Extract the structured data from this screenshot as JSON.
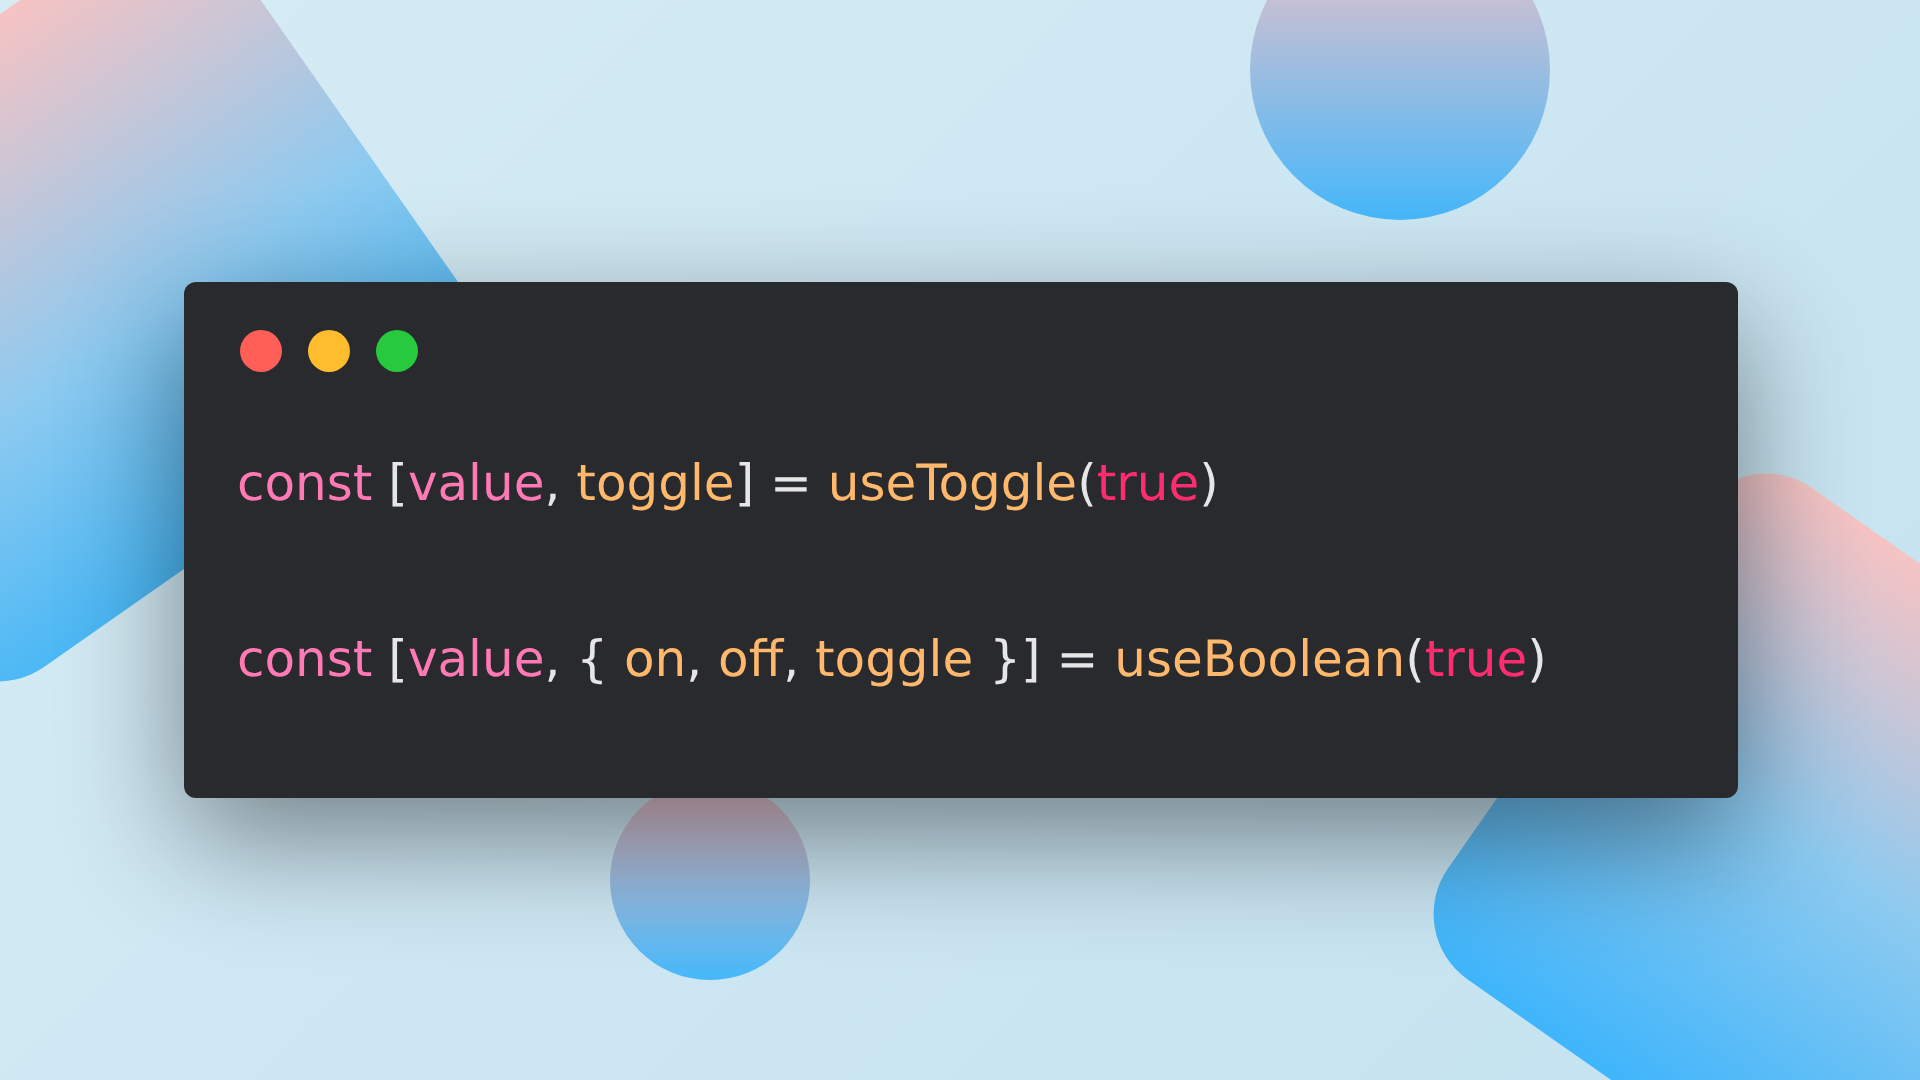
{
  "window": {
    "controls": [
      {
        "kind": "close"
      },
      {
        "kind": "minimize"
      },
      {
        "kind": "zoom"
      }
    ]
  },
  "code": {
    "lines": [
      [
        {
          "kind": "keyword",
          "text": "const "
        },
        {
          "kind": "punctuation",
          "text": "["
        },
        {
          "kind": "variable",
          "text": "value"
        },
        {
          "kind": "punctuation",
          "text": ", "
        },
        {
          "kind": "name",
          "text": "toggle"
        },
        {
          "kind": "punctuation",
          "text": "] = "
        },
        {
          "kind": "name",
          "text": "useToggle"
        },
        {
          "kind": "punctuation",
          "text": "("
        },
        {
          "kind": "literal",
          "text": "true"
        },
        {
          "kind": "punctuation",
          "text": ")"
        }
      ],
      [
        {
          "kind": "keyword",
          "text": "const "
        },
        {
          "kind": "punctuation",
          "text": "["
        },
        {
          "kind": "variable",
          "text": "value"
        },
        {
          "kind": "punctuation",
          "text": ", { "
        },
        {
          "kind": "name",
          "text": "on"
        },
        {
          "kind": "punctuation",
          "text": ", "
        },
        {
          "kind": "name",
          "text": "off"
        },
        {
          "kind": "punctuation",
          "text": ", "
        },
        {
          "kind": "name",
          "text": "toggle"
        },
        {
          "kind": "punctuation",
          "text": " }] = "
        },
        {
          "kind": "name",
          "text": "useBoolean"
        },
        {
          "kind": "punctuation",
          "text": "("
        },
        {
          "kind": "literal",
          "text": "true"
        },
        {
          "kind": "punctuation",
          "text": ")"
        }
      ]
    ]
  }
}
